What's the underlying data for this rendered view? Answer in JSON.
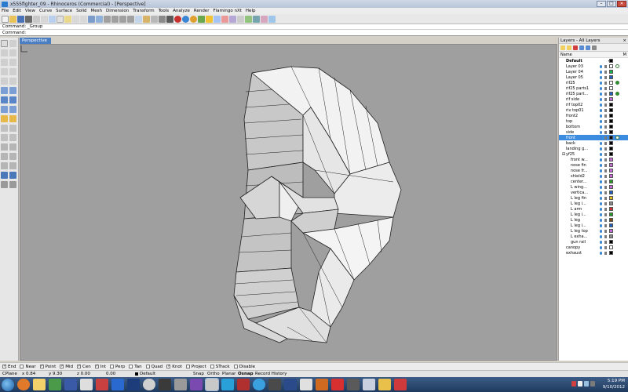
{
  "titlebar": {
    "title": "x555fighter_09 - Rhinoceros (Commercial) - [Perspective]"
  },
  "menu": [
    "File",
    "Edit",
    "View",
    "Curve",
    "Surface",
    "Solid",
    "Mesh",
    "Dimension",
    "Transform",
    "Tools",
    "Analyze",
    "Render",
    "Flamingo nXt",
    "Help"
  ],
  "command": {
    "history": "Command: _Group",
    "prompt": "Command:"
  },
  "viewport": {
    "name": "Perspective"
  },
  "layers_panel": {
    "title": "Layers - All Layers",
    "col_name": "Name",
    "col_m": "M",
    "rows": [
      {
        "name": "Default",
        "bold": true,
        "current": true,
        "color": "#000000"
      },
      {
        "name": "Layer 03",
        "color": "#ffffff",
        "extra": "#ffffff"
      },
      {
        "name": "Layer 04",
        "color": "#18b04a"
      },
      {
        "name": "Layer 05",
        "color": "#1f5fbf"
      },
      {
        "name": "rif25",
        "color": "#ffffff",
        "extra": "#2a9a2a"
      },
      {
        "name": "rif25 parts1",
        "color": "#ffffff"
      },
      {
        "name": "rif25 part...",
        "color": "#1f5fbf",
        "extra": "#2a9a2a"
      },
      {
        "name": "rif side",
        "color": "#c36ad6"
      },
      {
        "name": "rif top02",
        "color": "#000000"
      },
      {
        "name": "riv top01",
        "color": "#000000"
      },
      {
        "name": "front2",
        "color": "#000000"
      },
      {
        "name": "top",
        "color": "#000000"
      },
      {
        "name": "bottom",
        "color": "#000000"
      },
      {
        "name": "side",
        "color": "#000000"
      },
      {
        "name": "front",
        "color": "#000000",
        "selected": true,
        "extra": "#ffffff"
      },
      {
        "name": "back",
        "color": "#000000"
      },
      {
        "name": "landing g...",
        "color": "#000000"
      },
      {
        "name": "yf25",
        "color": "#000000",
        "toggle": "⊟"
      },
      {
        "name": "front w...",
        "color": "#c36ad6",
        "indent": true
      },
      {
        "name": "nose fin",
        "color": "#c36ad6",
        "indent": true
      },
      {
        "name": "nose fr...",
        "color": "#c36ad6",
        "indent": true
      },
      {
        "name": "shield2",
        "color": "#c36ad6",
        "indent": true
      },
      {
        "name": "center...",
        "color": "#2a9a2a",
        "indent": true
      },
      {
        "name": "L wing...",
        "color": "#c36ad6",
        "indent": true
      },
      {
        "name": "vertica...",
        "color": "#1f5fbf",
        "indent": true
      },
      {
        "name": "L leg fin",
        "color": "#e0c020",
        "indent": true
      },
      {
        "name": "L leg i...",
        "color": "#8a8a8a",
        "indent": true
      },
      {
        "name": "L arm",
        "color": "#c83030",
        "indent": true
      },
      {
        "name": "L leg i...",
        "color": "#2a9a2a",
        "indent": true
      },
      {
        "name": "L leg",
        "color": "#7a4a1a",
        "indent": true
      },
      {
        "name": "L leg i...",
        "color": "#1f5fbf",
        "indent": true
      },
      {
        "name": "L leg top",
        "color": "#c36ad6",
        "indent": true
      },
      {
        "name": "L exha...",
        "color": "#8a8a8a",
        "indent": true
      },
      {
        "name": "gun rail",
        "color": "#000000",
        "indent": true
      },
      {
        "name": "canopy",
        "color": "#ffffff"
      },
      {
        "name": "exhaust",
        "color": "#000000"
      }
    ]
  },
  "osnap": [
    {
      "label": "End",
      "on": true
    },
    {
      "label": "Near",
      "on": false
    },
    {
      "label": "Point",
      "on": true
    },
    {
      "label": "Mid",
      "on": true
    },
    {
      "label": "Cen",
      "on": true
    },
    {
      "label": "Int",
      "on": true
    },
    {
      "label": "Perp",
      "on": false
    },
    {
      "label": "Tan",
      "on": false
    },
    {
      "label": "Quad",
      "on": false
    },
    {
      "label": "Knot",
      "on": true
    },
    {
      "label": "Project",
      "on": false
    },
    {
      "label": "STrack",
      "on": false
    },
    {
      "label": "Disable",
      "on": false
    }
  ],
  "status": {
    "cplane": "CPlane",
    "x": "x 0.84",
    "y": "y 9.30",
    "z": "z 0.00",
    "units": "0.00",
    "layer": "Default",
    "snap": "Snap",
    "ortho": "Ortho",
    "planar": "Planar",
    "osnap": "Osnap",
    "record_history": "Record History"
  },
  "taskbar": {
    "time": "5:19 PM",
    "date": "9/10/2012"
  },
  "colors": {
    "viewport_bg": "#9f9f9f",
    "viewport_tab": "#4b7ec2",
    "selected_row": "#3b8ce0"
  }
}
